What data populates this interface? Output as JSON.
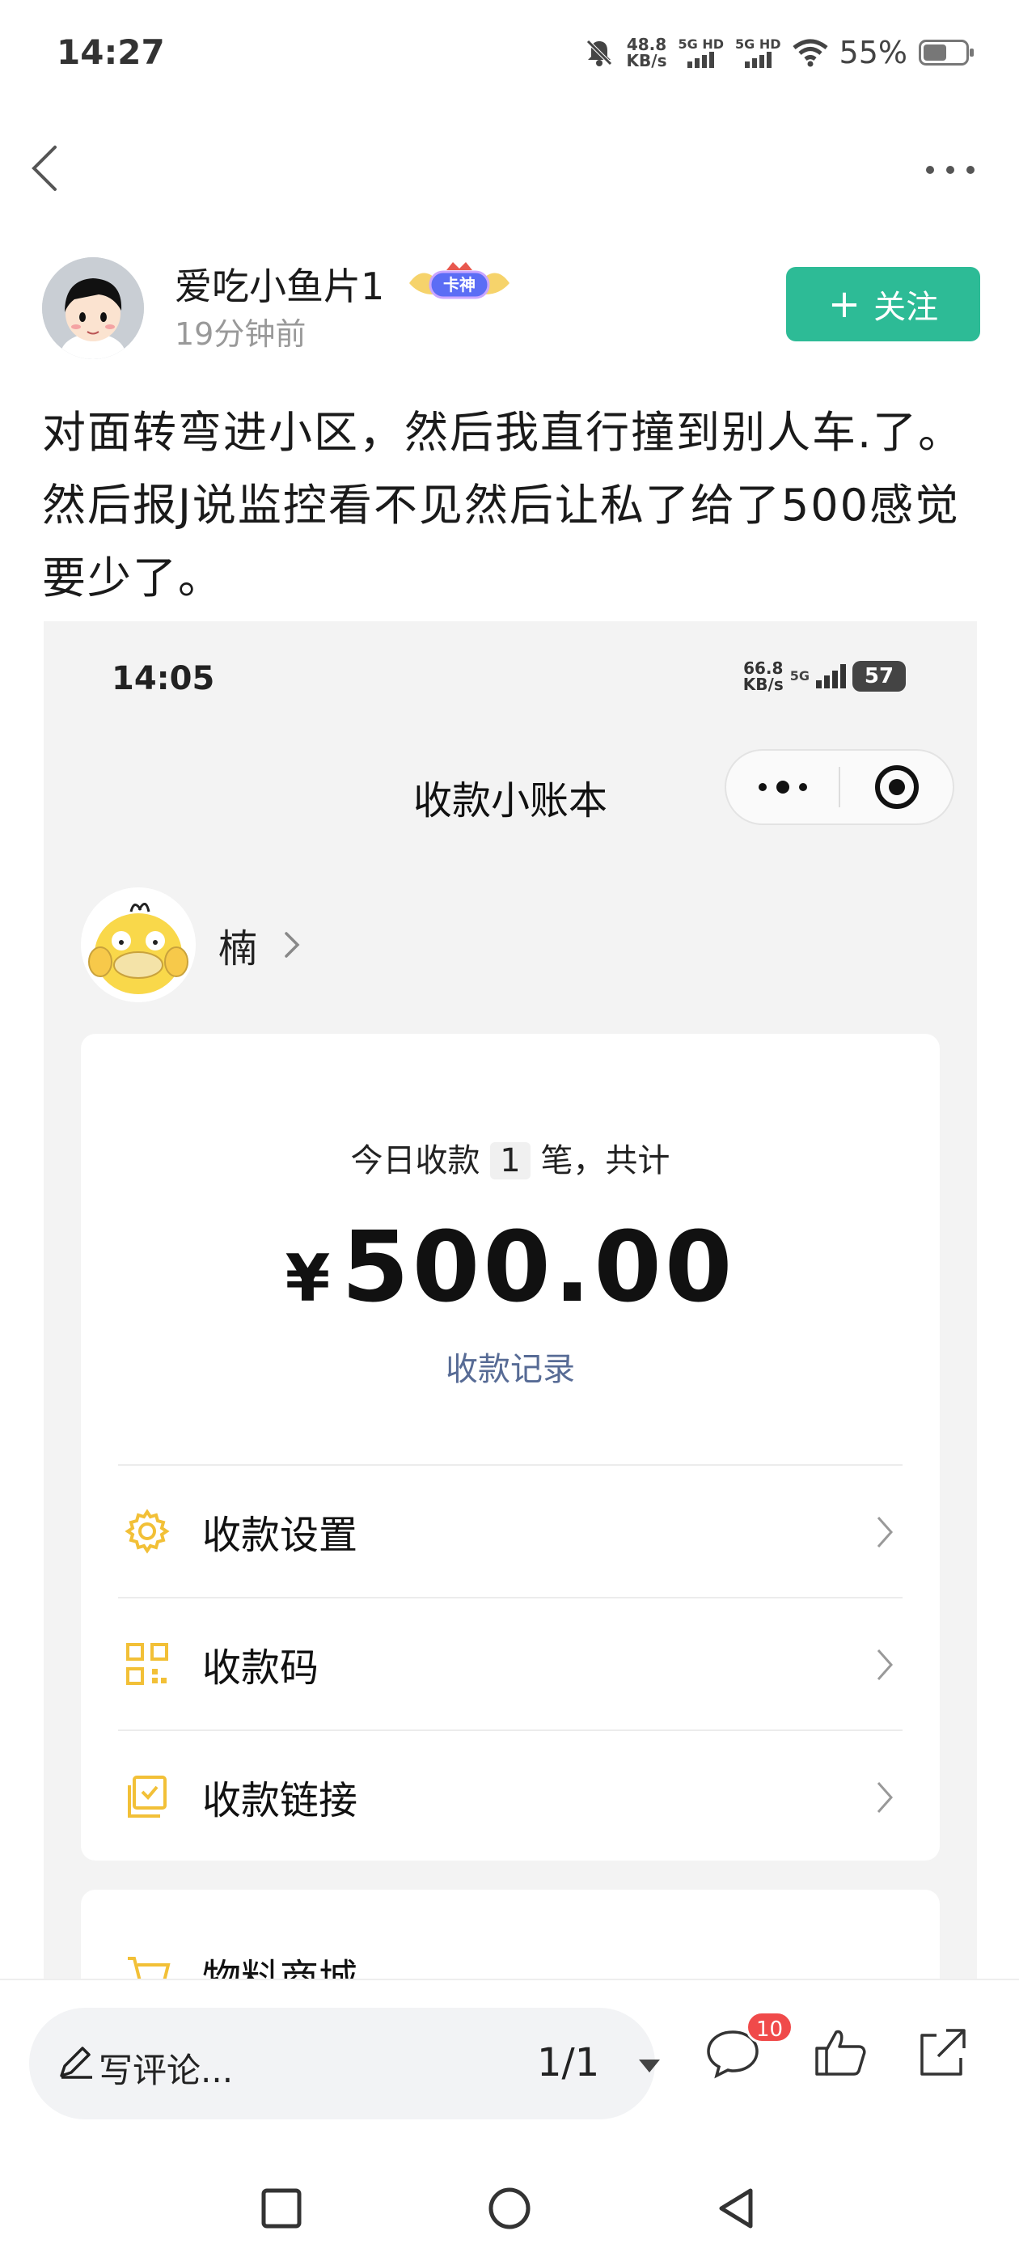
{
  "status_bar": {
    "time": "14:27",
    "net_speed_top": "48.8",
    "net_speed_unit": "KB/s",
    "signal1_label": "5G HD",
    "signal2_label": "5G HD",
    "battery_text": "55%",
    "battery_level": 0.55
  },
  "post": {
    "author_name": "爱吃小鱼片1",
    "badge_label": "卡神",
    "post_time": "19分钟前",
    "follow_label": "关注",
    "follow_plus": "+",
    "text": "对面转弯进小区，然后我直行撞到别人车.了。然后报J说监控看不见然后让私了给了500感觉要少了。"
  },
  "embedded": {
    "status_time": "14:05",
    "net_speed_top": "66.8",
    "net_speed_unit": "KB/s",
    "signal_label": "5G",
    "battery_text": "57",
    "title": "收款小账本",
    "user_name": "楠",
    "today_prefix": "今日收款",
    "today_count": "1",
    "today_suffix": "笔，共计",
    "amount_symbol": "¥",
    "amount": "500.00",
    "records_link": "收款记录",
    "menu": [
      {
        "label": "收款设置",
        "icon": "gear-icon"
      },
      {
        "label": "收款码",
        "icon": "qr-code-icon"
      },
      {
        "label": "收款链接",
        "icon": "link-icon"
      }
    ],
    "card2_item_label": "物料商城"
  },
  "bottom_bar": {
    "comment_placeholder": "写评论...",
    "page_indicator": "1/1",
    "comment_count": "10"
  },
  "colors": {
    "follow_green": "#2dbb96",
    "link_blue": "#576b95",
    "icon_yellow": "#f2c037",
    "badge_red": "#f04a4a"
  }
}
